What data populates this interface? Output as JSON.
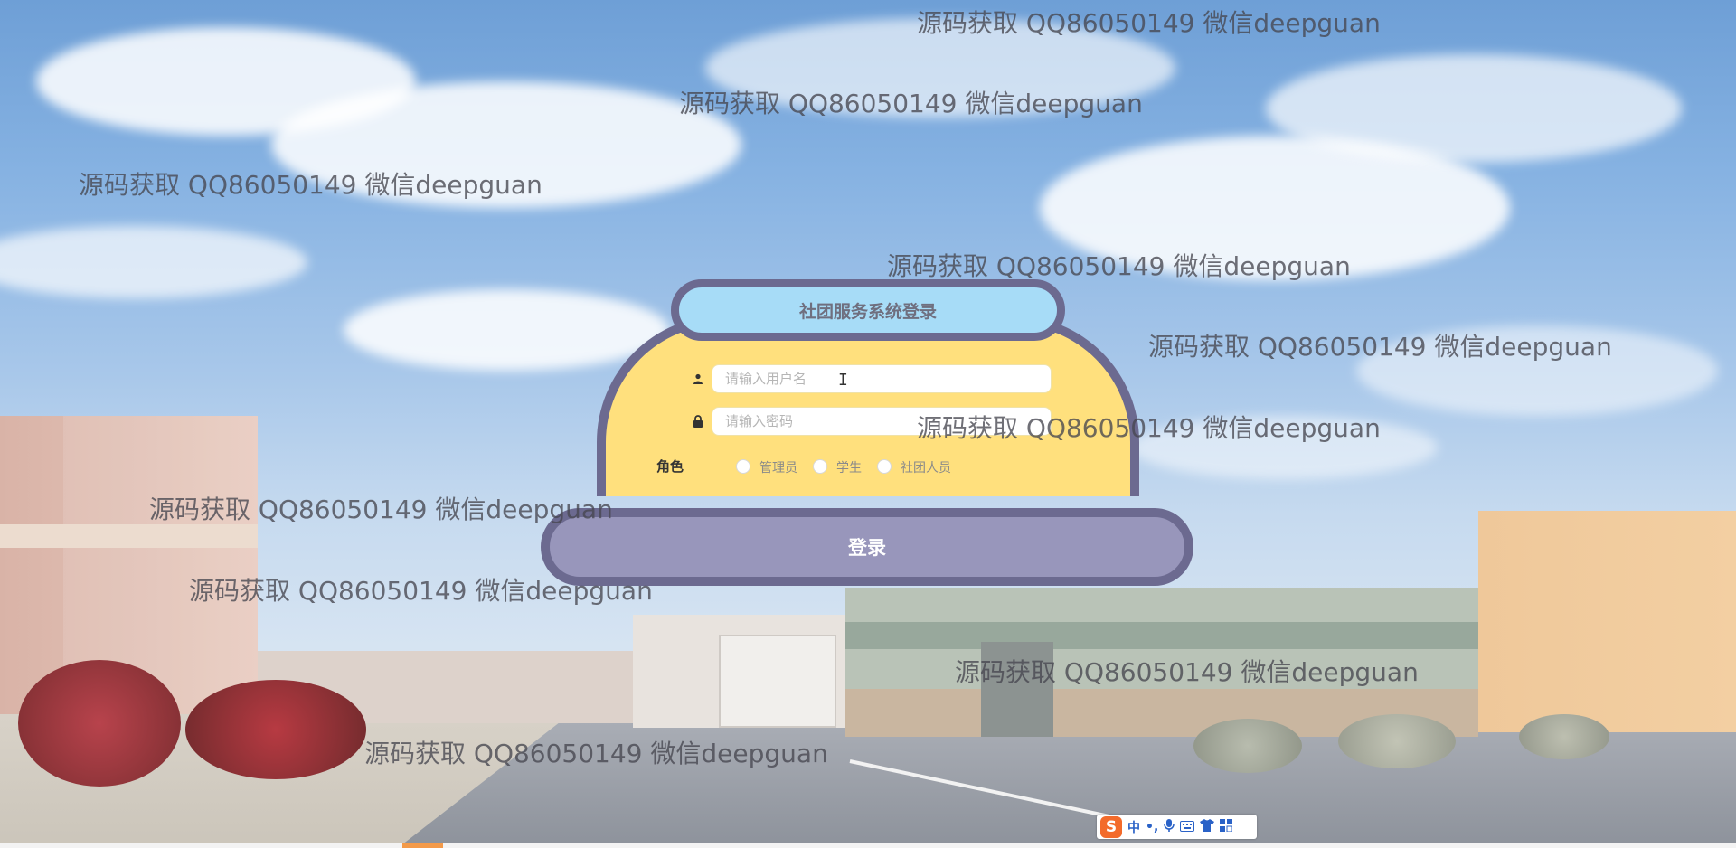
{
  "login": {
    "title": "社团服务系统登录",
    "username_placeholder": "请输入用户名",
    "password_placeholder": "请输入密码",
    "role_label": "角色",
    "roles": [
      "管理员",
      "学生",
      "社团人员"
    ],
    "submit_label": "登录"
  },
  "icons": {
    "username": "user-icon",
    "password": "lock-icon"
  },
  "colors": {
    "card_fill": "#ffe07d",
    "card_border": "#6c6a90",
    "title_fill": "#a7dcf7",
    "button_fill": "#9896bb"
  },
  "watermarks": [
    "源码获取 QQ86050149 微信deepguan",
    "源码获取 QQ86050149 微信deepguan",
    "源码获取 QQ86050149 微信deepguan",
    "源码获取 QQ86050149 微信deepguan",
    "源码获取 QQ86050149 微信deepguan",
    "源码获取 QQ86050149 微信deepguan",
    "源码获取 QQ86050149 微信deepguan",
    "源码获取 QQ86050149 微信deepguan",
    "源码获取 QQ86050149 微信deepguan",
    "源码获取 QQ86050149 微信deepguan"
  ],
  "ime_toolbar": {
    "logo": "S",
    "mode": "中",
    "punct": "•,",
    "items": [
      "mic-icon",
      "keyboard-icon",
      "shirt-icon",
      "grid-icon"
    ]
  }
}
